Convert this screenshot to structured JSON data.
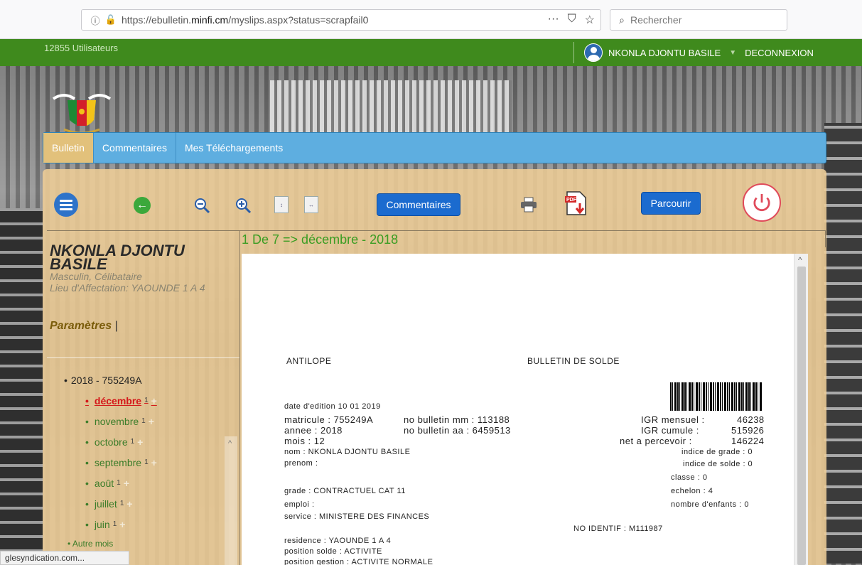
{
  "browser": {
    "url_prefix": "https://ebulletin.",
    "url_domain": "minfi.cm",
    "url_suffix": "/myslips.aspx?status=scrapfail0",
    "search_placeholder": "Rechercher"
  },
  "topbar": {
    "users_count": "12855 Utilisateurs",
    "user_name": "NKONLA DJONTU BASILE",
    "logout": "DECONNEXION"
  },
  "nav": {
    "tabs": [
      {
        "label": "Bulletin",
        "active": true
      },
      {
        "label": "Commentaires",
        "active": false
      },
      {
        "label": "Mes Téléchargements",
        "active": false
      }
    ]
  },
  "toolbar": {
    "comments_label": "Commentaires",
    "browse_label": "Parcourir"
  },
  "profile": {
    "name": "NKONLA DJONTU BASILE",
    "gender_status": "Masculin, Célibataire",
    "assignment": "Lieu d'Affectation: YAOUNDE 1 A 4",
    "params_label": "Paramètres",
    "params_sep": "|"
  },
  "tree": {
    "year": "2018 - 755249A",
    "months": [
      {
        "label": "décembre",
        "count": "1",
        "selected": true
      },
      {
        "label": "novembre",
        "count": "1",
        "selected": false
      },
      {
        "label": "octobre",
        "count": "1",
        "selected": false
      },
      {
        "label": "septembre",
        "count": "1",
        "selected": false
      },
      {
        "label": "août",
        "count": "1",
        "selected": false
      },
      {
        "label": "juillet",
        "count": "1",
        "selected": false
      },
      {
        "label": "juin",
        "count": "1",
        "selected": false
      }
    ],
    "other": "Autre mois",
    "plus": "+"
  },
  "status_tooltip": "glesyndication.com...",
  "viewer": {
    "title": "1 De 7    =>  décembre - 2018"
  },
  "slip": {
    "left_header": "ANTILOPE",
    "right_header": "BULLETIN DE SOLDE",
    "edition_date": "date d'edition 10 01 2019",
    "matricule": "matricule : 755249A",
    "annee": "annee       :  2018",
    "mois": "mois          :  12",
    "nom": "nom       :   NKONLA DJONTU BASILE",
    "prenom": "prenom  :",
    "bulletin_mm": "no bulletin mm :  113188",
    "bulletin_aa": "no bulletin aa :  6459513",
    "igr_mensuel_label": "IGR mensuel :",
    "igr_mensuel_value": "46238",
    "igr_cumule_label": "IGR cumule   :",
    "igr_cumule_value": "515926",
    "net_label": "net a percevoir  :",
    "net_value": "146224",
    "indice_grade": "indice de grade  :  0",
    "indice_solde": "indice de solde  :  0",
    "classe": "classe  :  0",
    "echelon": "echelon  :  4",
    "enfants": "nombre d'enfants  :  0",
    "grade": "grade  :   CONTRACTUEL CAT 11",
    "emploi": "emploi  :",
    "service": "service  :   MINISTERE DES FINANCES",
    "no_identif": "NO IDENTIF  :   M111987",
    "residence": "residence  :    YAOUNDE 1 A 4",
    "position_solde": "position solde        :   ACTIVITE",
    "position_gestion": "position gestion      :   ACTIVITE NORMALE"
  },
  "colors": {
    "green_bar": "#3f8a1d",
    "nav_blue": "#5eaee0",
    "tab_active": "#e2c17b",
    "button_blue": "#1b6bcf",
    "selected_red": "#d4181a",
    "link_green": "#3c7d2a"
  }
}
